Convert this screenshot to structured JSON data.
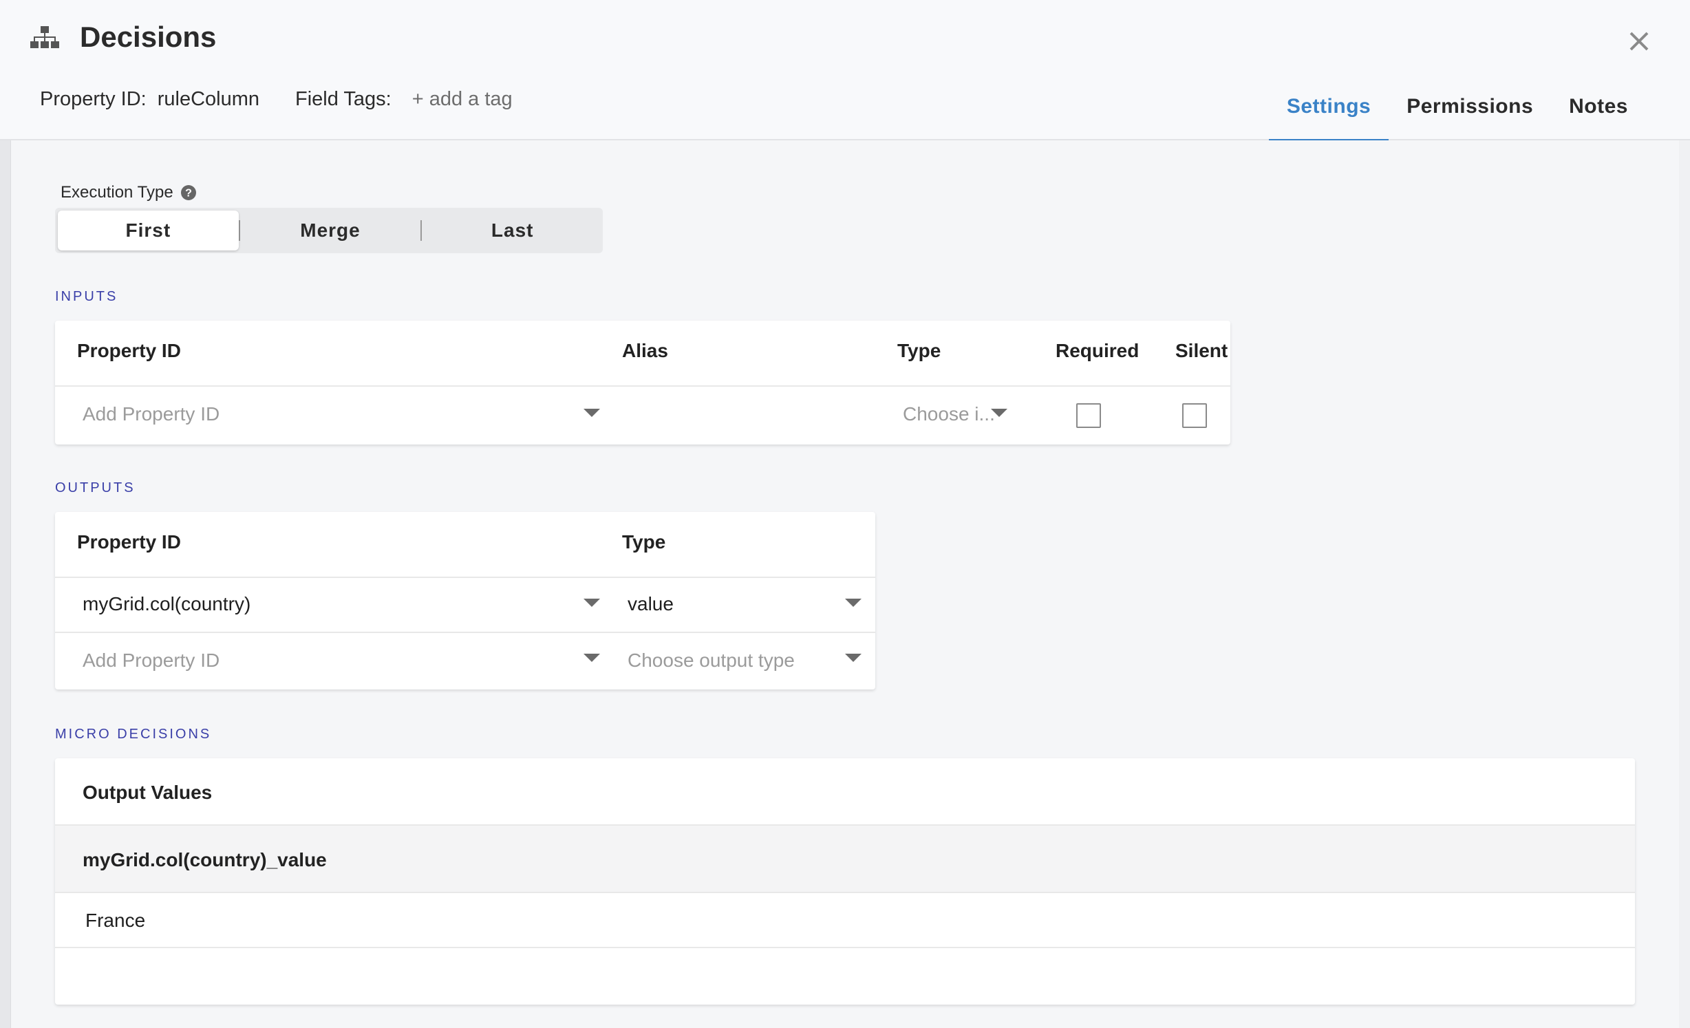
{
  "header": {
    "title": "Decisions",
    "property_id_label": "Property ID:",
    "property_id_value": "ruleColumn",
    "field_tags_label": "Field Tags:",
    "add_tag": "+ add a tag",
    "tabs": [
      {
        "label": "Settings",
        "active": true
      },
      {
        "label": "Permissions",
        "active": false
      },
      {
        "label": "Notes",
        "active": false
      }
    ]
  },
  "execution": {
    "label": "Execution Type",
    "options": [
      "First",
      "Merge",
      "Last"
    ],
    "selected": "First"
  },
  "inputs": {
    "section_label": "INPUTS",
    "headers": [
      "Property ID",
      "Alias",
      "Type",
      "Required",
      "Silent"
    ],
    "row": {
      "property_placeholder": "Add Property ID",
      "type_placeholder": "Choose i...",
      "required": false,
      "silent": false
    }
  },
  "outputs": {
    "section_label": "OUTPUTS",
    "headers": [
      "Property ID",
      "Type"
    ],
    "rows": [
      {
        "property": "myGrid.col(country)",
        "type": "value"
      }
    ],
    "new_row": {
      "property_placeholder": "Add Property ID",
      "type_placeholder": "Choose output type"
    }
  },
  "micro": {
    "section_label": "MICRO DECISIONS",
    "header": "Output Values",
    "column": "myGrid.col(country)_value",
    "values": [
      "France"
    ]
  },
  "colors": {
    "accent": "#3a82c7",
    "section_label": "#3a3fa8"
  }
}
